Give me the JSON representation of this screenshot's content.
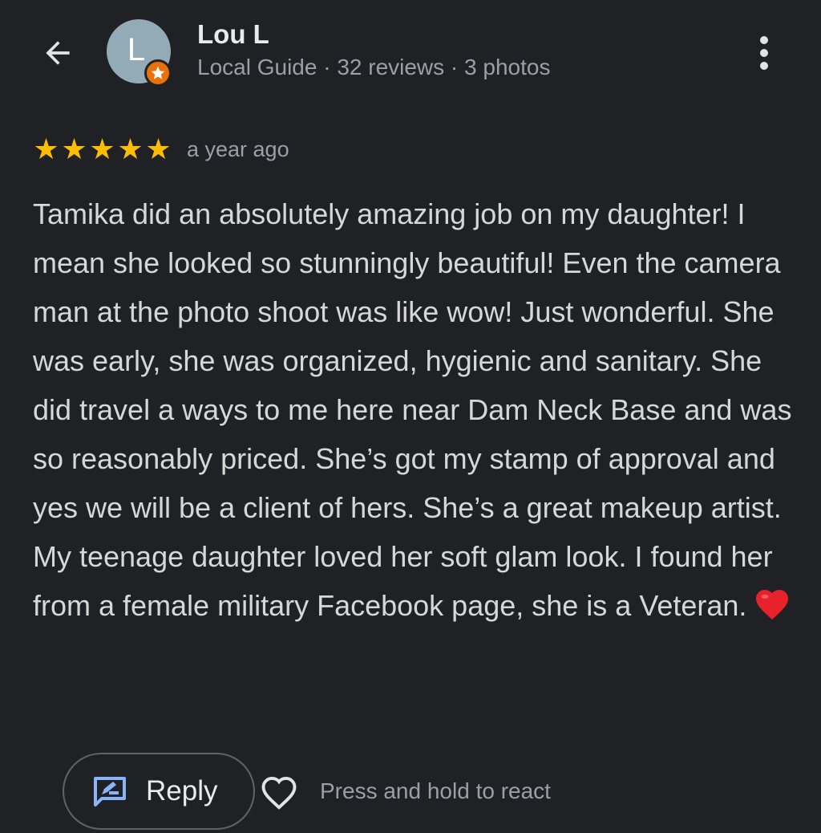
{
  "header": {
    "avatar_letter": "L",
    "user_name": "Lou L",
    "user_meta": "Local Guide · 32 reviews · 3 photos"
  },
  "review": {
    "rating": 5,
    "max_rating": 5,
    "time_ago": "a year ago",
    "text": "Tamika did an absolutely amazing job on my daughter! I mean she looked so stunningly beautiful! Even the camera man at the photo shoot was like wow! Just wonderful. She was early, she was organized, hygienic and sanitary. She did travel a ways to me here near Dam Neck Base and was so reasonably priced. She’s got my stamp of approval and yes we will be a client of hers. She’s a great makeup artist. My teenage daughter loved her soft glam look. I found her from a female military Facebook page, she is a Veteran.",
    "emoji": "heart"
  },
  "actions": {
    "reply_label": "Reply",
    "react_hint": "Press and hold to react"
  },
  "icons": {
    "back": "arrow-back-icon",
    "more": "more-vert-icon",
    "badge": "local-guide-star-icon",
    "reply": "reply-edit-icon",
    "react": "heart-outline-icon"
  },
  "colors": {
    "background": "#202124",
    "star": "#fbbc04",
    "badge": "#e8710a",
    "reply_icon": "#8ab4f8",
    "heart_emoji": "#e8222b"
  }
}
